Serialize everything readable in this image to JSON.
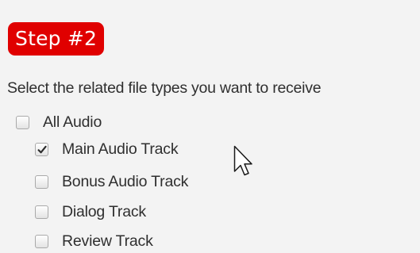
{
  "step_badge": {
    "label": "Step #2",
    "color": "#e00000"
  },
  "instruction": "Select the related file types you want to receive",
  "options": [
    {
      "label": "All Audio",
      "checked": false
    },
    {
      "label": "Main Audio Track",
      "checked": true
    },
    {
      "label": "Bonus Audio Track",
      "checked": false
    },
    {
      "label": "Dialog Track",
      "checked": false
    },
    {
      "label": "Review Track",
      "checked": false
    }
  ],
  "cursor": {
    "icon": "arrow-pointer"
  }
}
